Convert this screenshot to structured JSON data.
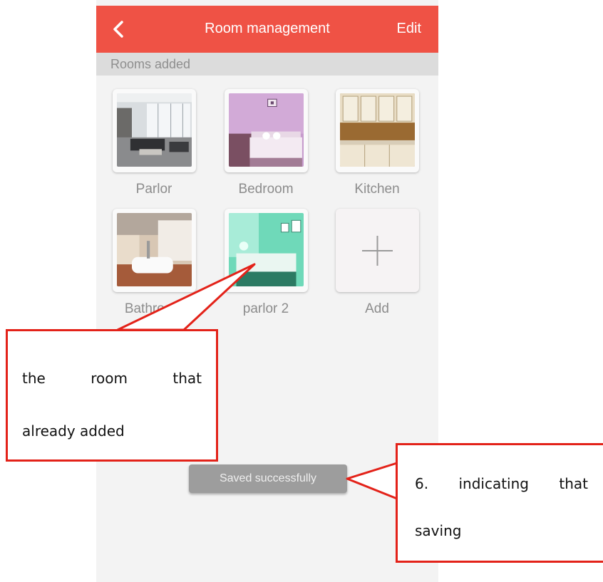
{
  "header": {
    "title": "Room management",
    "edit_label": "Edit"
  },
  "section": {
    "label": "Rooms added"
  },
  "rooms": [
    {
      "label": "Parlor"
    },
    {
      "label": "Bedroom"
    },
    {
      "label": "Kitchen"
    },
    {
      "label": "Bathroom"
    },
    {
      "label": "parlor 2"
    }
  ],
  "add": {
    "label": "Add"
  },
  "toast": {
    "text": "Saved successfully"
  },
  "annotations": {
    "callout_1": {
      "line1": "the room that",
      "line2": "already added"
    },
    "callout_2": {
      "line1": "6. indicating that",
      "line2": "saving"
    }
  },
  "colors": {
    "header": "#ef5245",
    "callout_border": "#e32219",
    "toast": "#9d9d9d"
  }
}
